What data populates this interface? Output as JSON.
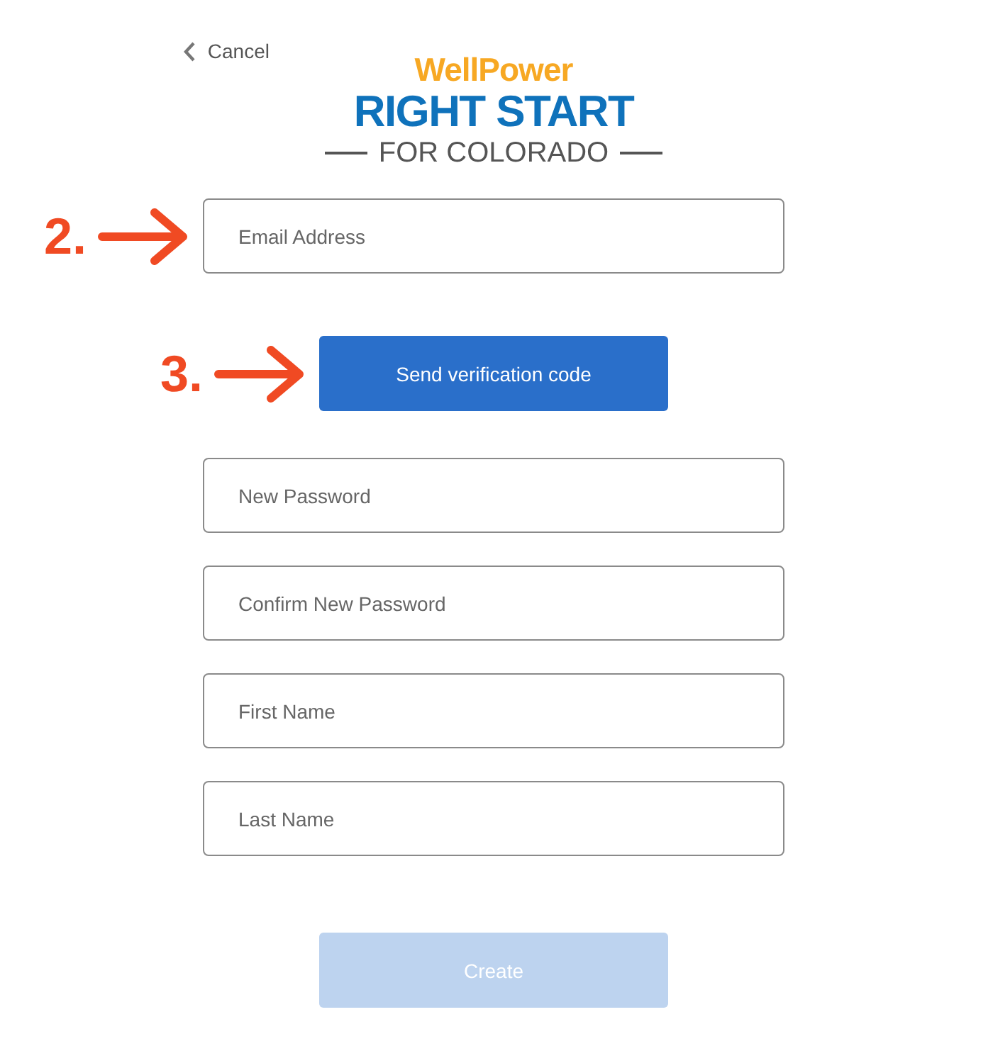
{
  "header": {
    "cancel": "Cancel",
    "logo": {
      "brand": "WellPower",
      "title": "RIGHT START",
      "subtitle": "FOR COLORADO"
    }
  },
  "form": {
    "items": [
      {
        "kind": "field",
        "placeholder": "Email Address",
        "step": "2."
      },
      {
        "kind": "button",
        "label": "Send verification code",
        "step": "3.",
        "disabled": false
      },
      {
        "kind": "field",
        "placeholder": "New Password"
      },
      {
        "kind": "field",
        "placeholder": "Confirm New Password"
      },
      {
        "kind": "field",
        "placeholder": "First Name"
      },
      {
        "kind": "field",
        "placeholder": "Last Name"
      },
      {
        "kind": "button",
        "label": "Create",
        "disabled": true
      }
    ]
  }
}
